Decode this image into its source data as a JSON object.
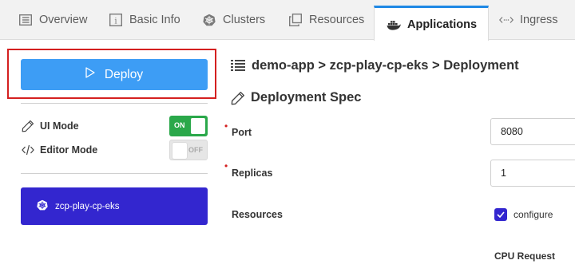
{
  "tabs": [
    {
      "label": "Overview",
      "icon": "list-icon"
    },
    {
      "label": "Basic Info",
      "icon": "info-icon"
    },
    {
      "label": "Clusters",
      "icon": "kubernetes-icon"
    },
    {
      "label": "Resources",
      "icon": "copy-icon"
    },
    {
      "label": "Applications",
      "icon": "docker-icon",
      "active": true
    },
    {
      "label": "Ingress",
      "icon": "code-arrows-icon"
    }
  ],
  "sidebar": {
    "deploy_label": "Deploy",
    "ui_mode": {
      "label": "UI Mode",
      "toggle_text": "ON",
      "state": "on"
    },
    "editor_mode": {
      "label": "Editor Mode",
      "toggle_text": "OFF",
      "state": "off"
    },
    "cluster_label": "zcp-play-cp-eks"
  },
  "main": {
    "breadcrumb": "demo-app > zcp-play-cp-eks > Deployment",
    "section_title": "Deployment Spec",
    "fields": {
      "port_label": "Port",
      "port_value": "8080",
      "replicas_label": "Replicas",
      "replicas_value": "1",
      "resources_label": "Resources",
      "configure_label": "configure",
      "configure_checked": true,
      "cpu_request_label": "CPU Request"
    }
  },
  "colors": {
    "accent_blue": "#3d9df5",
    "cluster_indigo": "#3326cf",
    "toggle_green": "#2aa84a",
    "highlight_red": "#d42020",
    "tab_active_border": "#1e88e5"
  }
}
